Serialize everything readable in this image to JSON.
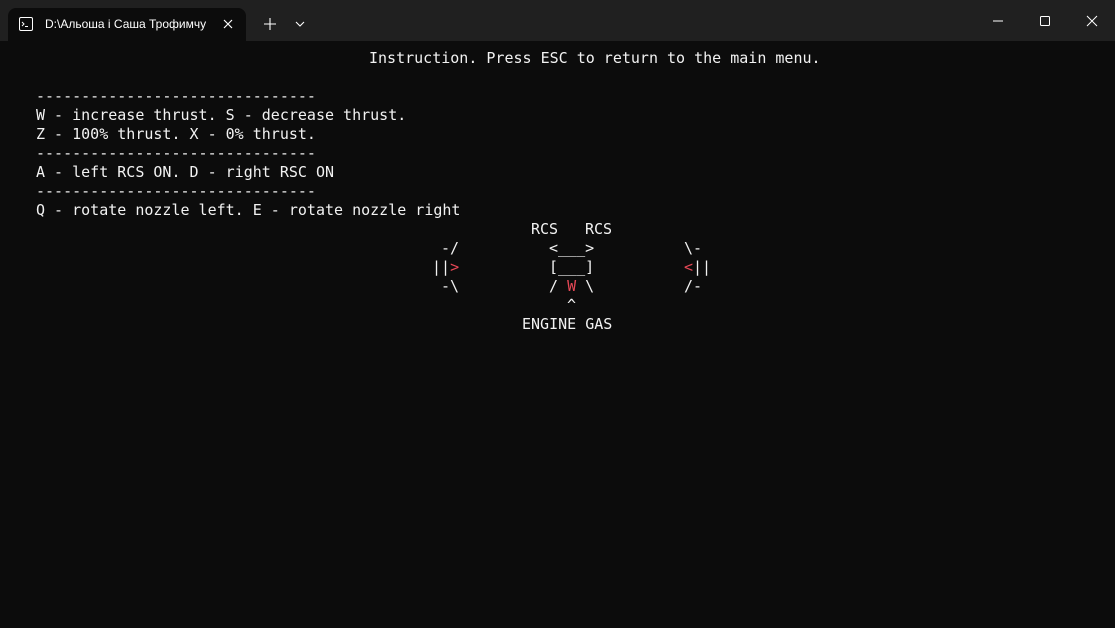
{
  "tab": {
    "title": "D:\\Альоша і Саша Трофимчу",
    "icon": "terminal-icon"
  },
  "titlebar": {
    "new_tab_icon": "plus-icon",
    "dropdown_icon": "chevron-down-icon",
    "minimize_icon": "minimize-icon",
    "maximize_icon": "maximize-icon",
    "close_icon": "close-icon"
  },
  "colors": {
    "background": "#0c0c0c",
    "text": "#f2f2f2",
    "accent_red": "#e74856",
    "titlebar": "#202020"
  },
  "terminal": {
    "header": "Instruction. Press ESC to return to the main menu.",
    "separator": "-------------------------------",
    "line_thrust_1": "W - increase thrust. S - decrease thrust.",
    "line_thrust_2": "Z - 100% thrust. X - 0% thrust.",
    "line_rcs": "A - left RCS ON. D - right RSC ON",
    "line_nozzle": "Q - rotate nozzle left. E - rotate nozzle right",
    "diagram": {
      "rcs_left_label": "RCS",
      "rcs_right_label": "RCS",
      "left_top": "-/",
      "left_mid_bars": "||",
      "left_mid_arrow": ">",
      "left_bot": "-\\",
      "ship_top": "<___>",
      "ship_mid": "[___]",
      "ship_bot_left": "/ ",
      "ship_bot_flame": "W",
      "ship_bot_right": " \\",
      "ship_caret": "^",
      "right_top": "\\-",
      "right_mid_arrow": "<",
      "right_mid_bars": "||",
      "right_bot": "/-",
      "engine_label": "ENGINE GAS"
    }
  }
}
